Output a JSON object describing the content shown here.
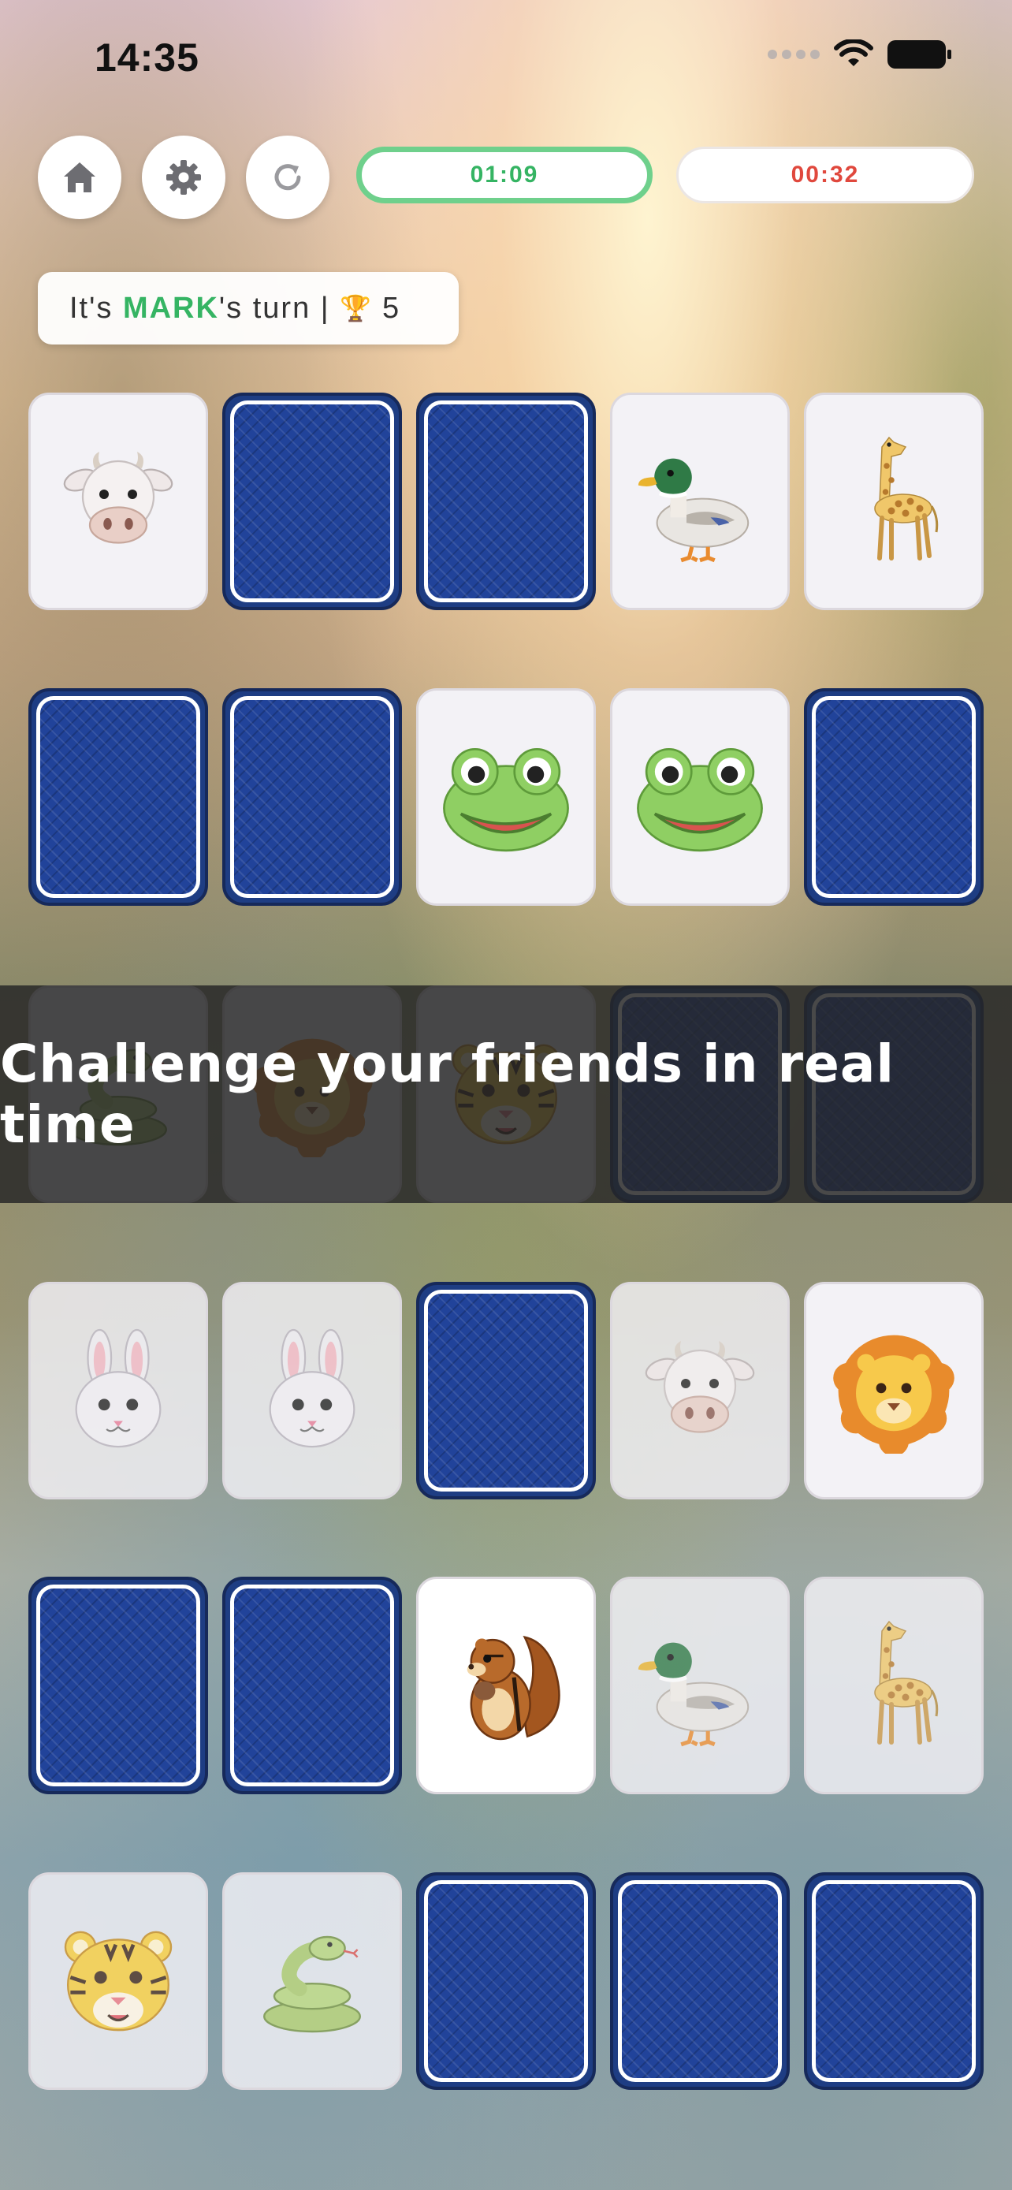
{
  "status_bar": {
    "time": "14:35"
  },
  "toolbar": {
    "home_icon": "home-icon",
    "settings_icon": "gear-icon",
    "restart_icon": "restart-icon"
  },
  "timers": {
    "player_timer": "01:09",
    "opponent_timer": "00:32",
    "player_color": "#35b463",
    "opponent_color": "#e0483d"
  },
  "turn": {
    "prefix": "It's ",
    "player": "MARK",
    "suffix": "'s turn | ",
    "trophy_icon": "🏆",
    "score": "5"
  },
  "banner": {
    "text": "Challenge your friends in real time"
  },
  "board": {
    "card_back_color": "#1e3d83",
    "rows": [
      [
        "cow",
        "back",
        "back",
        "duck",
        "giraffe"
      ],
      [
        "back",
        "back",
        "frog",
        "frog",
        "back"
      ],
      [
        "snake",
        "lion",
        "tiger",
        "back",
        "back"
      ],
      [
        "rabbit",
        "rabbit",
        "back",
        "cow",
        "lion"
      ],
      [
        "back",
        "back",
        "chipmunk",
        "duck",
        "giraffe"
      ],
      [
        "tiger",
        "snake",
        "back",
        "back",
        "back"
      ]
    ]
  }
}
